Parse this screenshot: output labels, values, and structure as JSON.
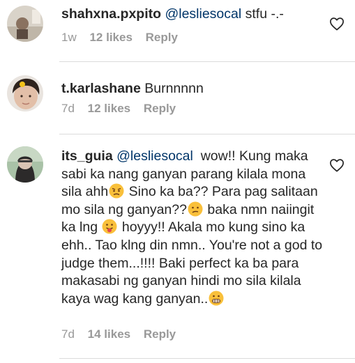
{
  "comments": [
    {
      "username": "shahxna.pxpito",
      "mention": "@lesliesocal",
      "text": "stfu -.-",
      "time": "1w",
      "likes": "12 likes",
      "reply": "Reply"
    },
    {
      "username": "t.karlashane",
      "text": "Burnnnnn",
      "time": "7d",
      "likes": "12 likes",
      "reply": "Reply"
    },
    {
      "username": "its_guia",
      "mention": "@lesliesocal",
      "text_1": "wow!! Kung maka sabi ka nang ganyan parang kilala mona sila ahh",
      "text_2": "Sino ka ba?? Para pag salitaan mo sila ng ganyan??",
      "text_3": "baka nmn naiingit ka lng",
      "text_4": "hoyyy!! Akala mo kung sino ka ehh.. Tao klng din nmn.. You're not a god to judge them...!!!! Baki perfect ka ba para makasabi ng ganyan hindi mo sila kilala kaya wag kang ganyan..",
      "time": "7d",
      "likes": "14 likes",
      "reply": "Reply"
    }
  ],
  "icons": {
    "like": "heart-outline-icon",
    "emoji_1": "angry-face-emoji",
    "emoji_2": "confused-face-emoji",
    "emoji_3": "tongue-face-emoji",
    "emoji_4": "grimacing-face-emoji"
  },
  "colors": {
    "text": "#262626",
    "meta": "#999999",
    "mention": "#003569",
    "divider": "#dbdbdb"
  }
}
